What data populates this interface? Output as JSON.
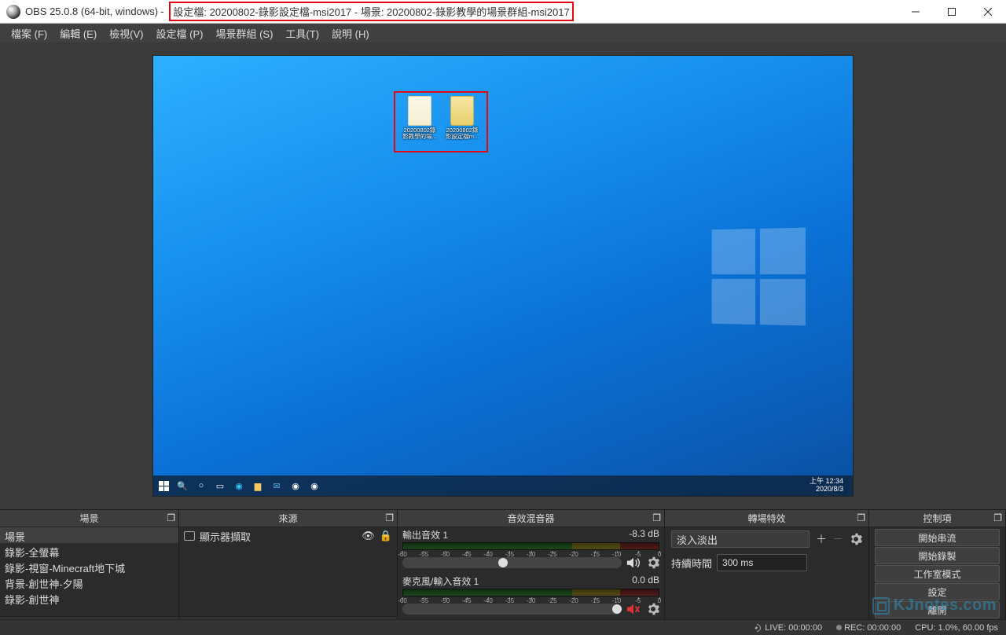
{
  "titlebar": {
    "app": "OBS 25.0.8 (64-bit, windows)",
    "highlighted": "設定檔: 20200802-錄影設定檔-msi2017 - 場景: 20200802-錄影教學的場景群組-msi2017"
  },
  "menu": {
    "file": "檔案 (F)",
    "edit": "編輯 (E)",
    "view": "檢視(V)",
    "profile": "設定檔 (P)",
    "scene_collection": "場景群組 (S)",
    "tools": "工具(T)",
    "help": "說明 (H)"
  },
  "preview": {
    "desktop_icons": [
      "20200802錄影教學的場...",
      "20200802錄影設定檔m..."
    ],
    "taskbar_clock_top": "上午 12:34",
    "taskbar_clock_bottom": "2020/8/3"
  },
  "panels": {
    "scenes": {
      "title": "場景",
      "items": [
        "場景",
        "錄影-全螢幕",
        "錄影-視窗-Minecraft地下城",
        "背景-創世神-夕陽",
        "錄影-創世神"
      ],
      "selected_index": 0
    },
    "sources": {
      "title": "來源",
      "items": [
        {
          "label": "顯示器擷取",
          "visible": true,
          "locked": true
        }
      ]
    },
    "mixer": {
      "title": "音效混音器",
      "channels": [
        {
          "name": "輸出音效 1",
          "db": "-8.3 dB",
          "fill": 0.6,
          "knob": 0.46,
          "muted": false
        },
        {
          "name": "麥克風/輸入音效 1",
          "db": "0.0 dB",
          "fill": 0.0,
          "knob": 0.98,
          "muted": true
        }
      ],
      "ticks": [
        "-60",
        "-55",
        "-50",
        "-45",
        "-40",
        "-35",
        "-30",
        "-25",
        "-20",
        "-15",
        "-10",
        "-5",
        "0"
      ]
    },
    "transitions": {
      "title": "轉場特效",
      "mode": "淡入淡出",
      "duration_label": "持續時間",
      "duration_value": "300 ms"
    },
    "controls": {
      "title": "控制項",
      "buttons": {
        "stream": "開始串流",
        "record": "開始錄製",
        "studio": "工作室模式",
        "settings": "設定",
        "exit": "離開"
      }
    }
  },
  "status": {
    "live": "LIVE: 00:00:00",
    "rec": "REC: 00:00:00",
    "cpu": "CPU: 1.0%, 60.00 fps"
  },
  "watermark": "KJnotes.com"
}
